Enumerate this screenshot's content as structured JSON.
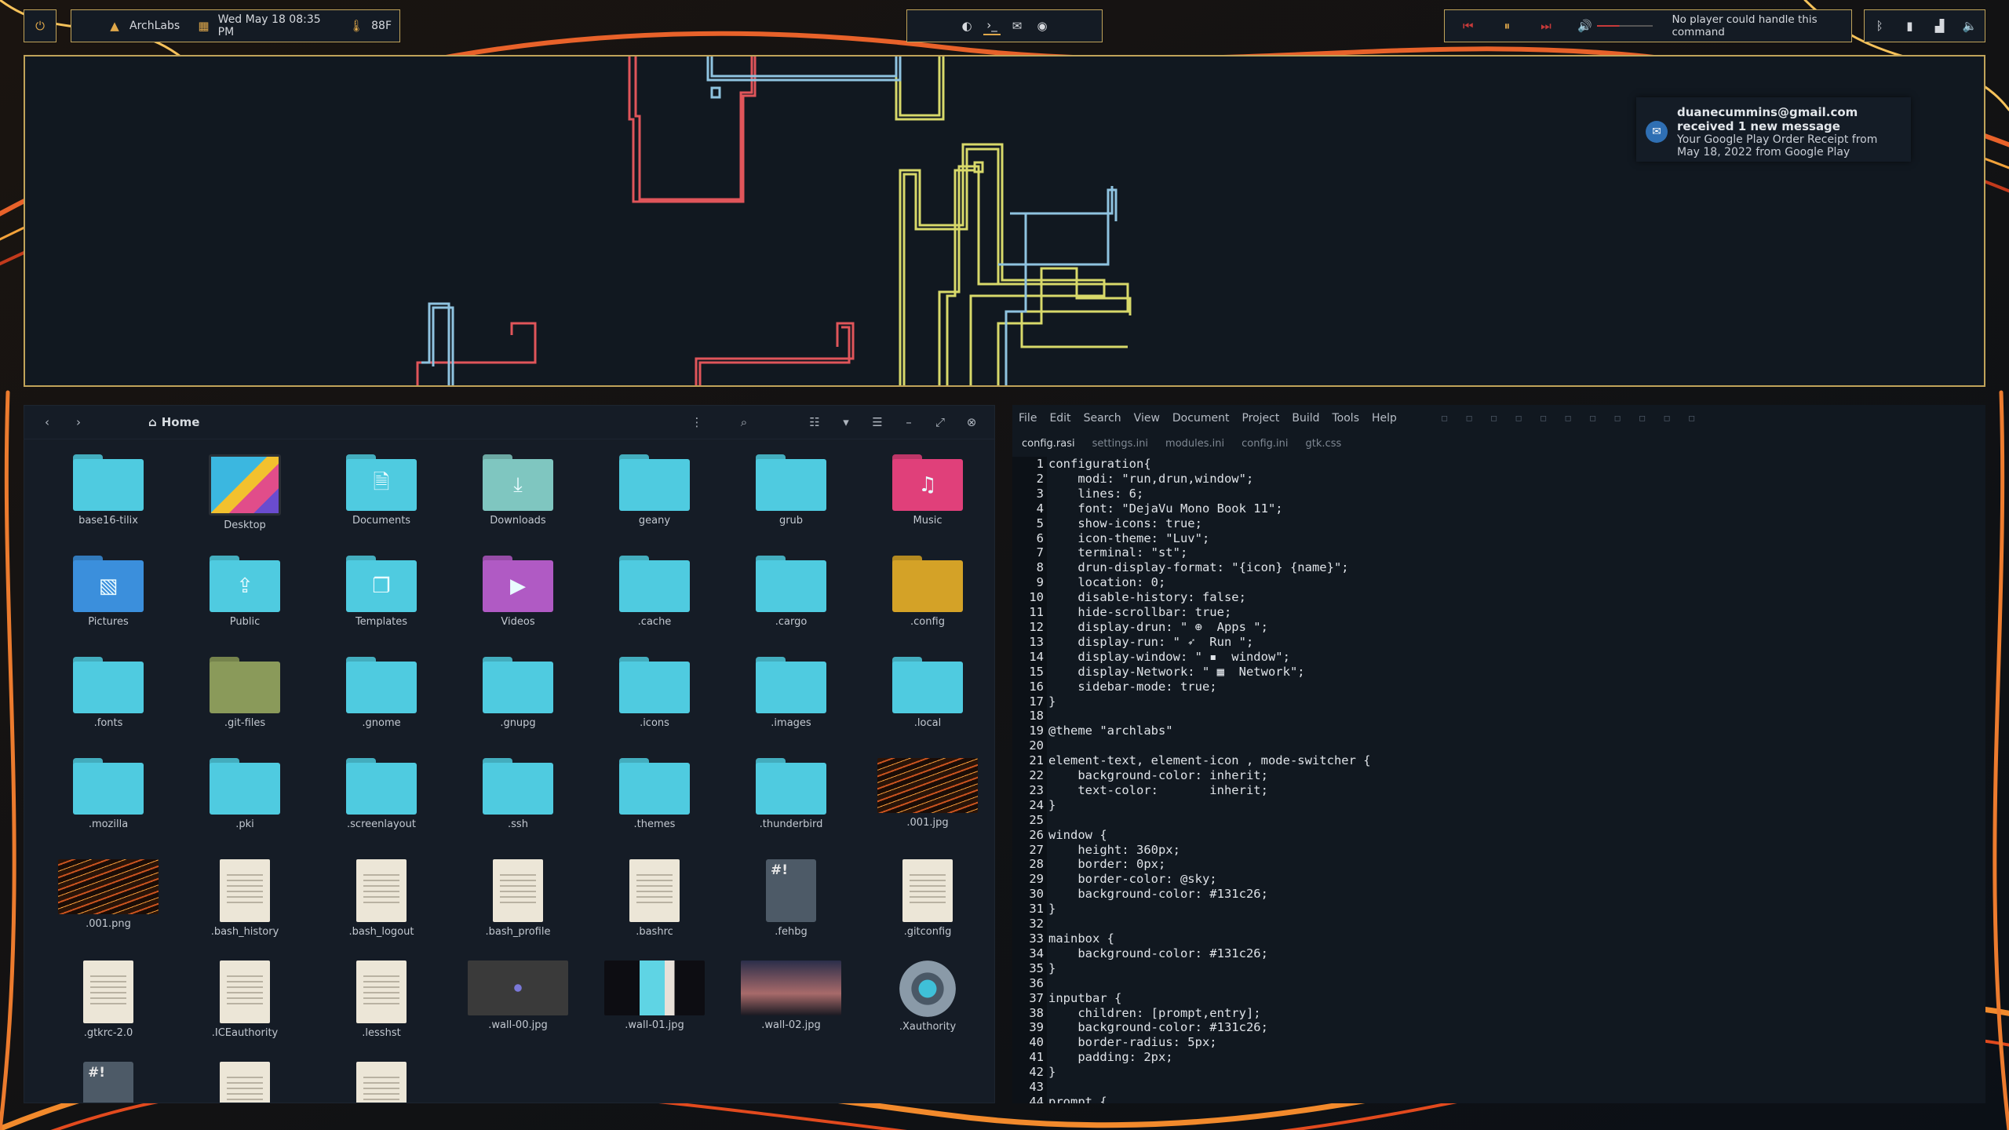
{
  "topbar": {
    "distro": "ArchLabs",
    "datetime": "Wed May 18 08:35 PM",
    "weather": "88F",
    "media_status": "No player could handle this command"
  },
  "notification": {
    "title": "duanecummins@gmail.com received 1 new message",
    "body": "Your Google Play Order Receipt from May 18, 2022 from Google Play"
  },
  "file_manager": {
    "location": "Home",
    "items": [
      {
        "name": "base16-tilix",
        "kind": "folder"
      },
      {
        "name": "Desktop",
        "kind": "desktop"
      },
      {
        "name": "Documents",
        "kind": "folder",
        "glyph": "🗎"
      },
      {
        "name": "Downloads",
        "kind": "folder-green",
        "glyph": "⤓"
      },
      {
        "name": "geany",
        "kind": "folder"
      },
      {
        "name": "grub",
        "kind": "folder"
      },
      {
        "name": "Music",
        "kind": "folder-pink",
        "glyph": "♫"
      },
      {
        "name": "Pictures",
        "kind": "folder-blue",
        "glyph": "▧"
      },
      {
        "name": "Public",
        "kind": "folder",
        "glyph": "⇪"
      },
      {
        "name": "Templates",
        "kind": "folder",
        "glyph": "❐"
      },
      {
        "name": "Videos",
        "kind": "folder-purple",
        "glyph": "▶"
      },
      {
        "name": ".cache",
        "kind": "folder"
      },
      {
        "name": ".cargo",
        "kind": "folder"
      },
      {
        "name": ".config",
        "kind": "folder-yellow"
      },
      {
        "name": ".fonts",
        "kind": "folder"
      },
      {
        "name": ".git-files",
        "kind": "folder-olive"
      },
      {
        "name": ".gnome",
        "kind": "folder"
      },
      {
        "name": ".gnupg",
        "kind": "folder"
      },
      {
        "name": ".icons",
        "kind": "folder"
      },
      {
        "name": ".images",
        "kind": "folder"
      },
      {
        "name": ".local",
        "kind": "folder"
      },
      {
        "name": ".mozilla",
        "kind": "folder"
      },
      {
        "name": ".pki",
        "kind": "folder"
      },
      {
        "name": ".screenlayout",
        "kind": "folder"
      },
      {
        "name": ".ssh",
        "kind": "folder"
      },
      {
        "name": ".themes",
        "kind": "folder"
      },
      {
        "name": ".thunderbird",
        "kind": "folder"
      },
      {
        "name": ".001.jpg",
        "kind": "thumb-swirl"
      },
      {
        "name": ".001.png",
        "kind": "thumb-swirl"
      },
      {
        "name": ".bash_history",
        "kind": "doc"
      },
      {
        "name": ".bash_logout",
        "kind": "doc"
      },
      {
        "name": ".bash_profile",
        "kind": "doc"
      },
      {
        "name": ".bashrc",
        "kind": "doc"
      },
      {
        "name": ".fehbg",
        "kind": "script",
        "glyph": "#!"
      },
      {
        "name": ".gitconfig",
        "kind": "doc"
      },
      {
        "name": ".gtkrc-2.0",
        "kind": "doc"
      },
      {
        "name": ".ICEauthority",
        "kind": "doc"
      },
      {
        "name": ".lesshst",
        "kind": "doc"
      },
      {
        "name": ".wall-00.jpg",
        "kind": "thumb-arch"
      },
      {
        "name": ".wall-01.jpg",
        "kind": "thumb-anime"
      },
      {
        "name": ".wall-02.jpg",
        "kind": "thumb-city"
      },
      {
        "name": ".Xauthority",
        "kind": "gear"
      },
      {
        "name": "",
        "kind": "script",
        "glyph": "#!"
      },
      {
        "name": "",
        "kind": "doc"
      },
      {
        "name": "",
        "kind": "doc"
      }
    ]
  },
  "editor": {
    "menu": [
      "File",
      "Edit",
      "Search",
      "View",
      "Document",
      "Project",
      "Build",
      "Tools",
      "Help"
    ],
    "tabs": [
      "config.rasi",
      "settings.ini",
      "modules.ini",
      "config.ini",
      "gtk.css"
    ],
    "active_tab": "config.rasi",
    "lines": [
      "configuration{",
      "    modi: \"run,drun,window\";",
      "    lines: 6;",
      "    font: \"DejaVu Mono Book 11\";",
      "    show-icons: true;",
      "    icon-theme: \"Luv\";",
      "    terminal: \"st\";",
      "    drun-display-format: \"{icon} {name}\";",
      "    location: 0;",
      "    disable-history: false;",
      "    hide-scrollbar: true;",
      "    display-drun: \" ⊕  Apps \";",
      "    display-run: \" ➶  Run \";",
      "    display-window: \" ▪  window\";",
      "    display-Network: \" ▦  Network\";",
      "    sidebar-mode: true;",
      "}",
      "",
      "@theme \"archlabs\"",
      "",
      "element-text, element-icon , mode-switcher {",
      "    background-color: inherit;",
      "    text-color:       inherit;",
      "}",
      "",
      "window {",
      "    height: 360px;",
      "    border: 0px;",
      "    border-color: @sky;",
      "    background-color: #131c26;",
      "}",
      "",
      "mainbox {",
      "    background-color: #131c26;",
      "}",
      "",
      "inputbar {",
      "    children: [prompt,entry];",
      "    background-color: #131c26;",
      "    border-radius: 5px;",
      "    padding: 2px;",
      "}",
      "",
      "prompt {"
    ]
  }
}
